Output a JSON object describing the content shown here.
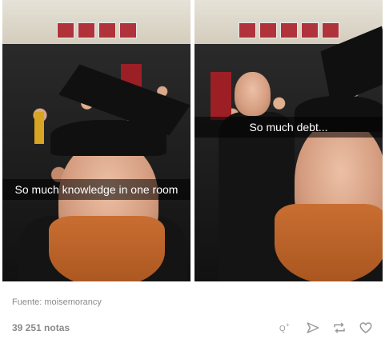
{
  "post": {
    "panels": [
      {
        "caption": "So much knowledge in one room"
      },
      {
        "caption": "So much debt..."
      }
    ],
    "source_label": "Fuente:",
    "source_name": "moisemorancy",
    "notes": "39 251 notas"
  },
  "actions": [
    {
      "icon": "reply-icon"
    },
    {
      "icon": "share-icon"
    },
    {
      "icon": "reblog-icon"
    },
    {
      "icon": "like-icon"
    }
  ],
  "colors": {
    "caption_bg": "#00000080",
    "meta_text": "#8a8a8a",
    "beard": "#c96e32"
  }
}
